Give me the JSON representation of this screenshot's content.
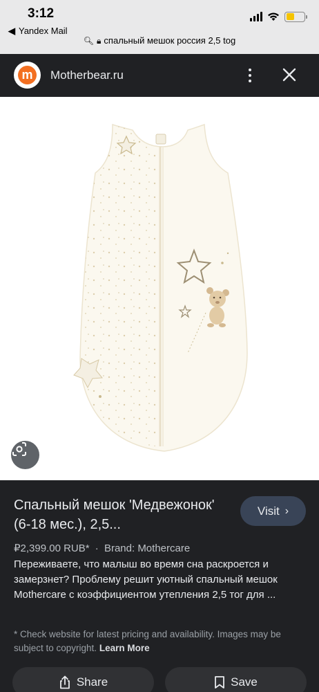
{
  "status_bar": {
    "time": "3:12",
    "back_app": "Yandex Mail",
    "url": "спальный мешок россия 2,5 tog",
    "battery_level": 0.45,
    "battery_color": "#f5c400"
  },
  "site": {
    "logo_letter": "m",
    "logo_color": "#f36f21",
    "name": "Motherbear.ru"
  },
  "product": {
    "title": "Спальный мешок 'Медвежонок' (6-18 мес.), 2,5...",
    "visit_label": "Visit",
    "price": "₽2,399.00 RUB*",
    "separator": "·",
    "brand": "Brand: Mothercare",
    "description": "Переживаете, что малыш во время сна раскроется и замерзнет? Проблему решит уютный спальный мешок Mothercare с коэффициентом утепления 2,5 тог для ...",
    "disclaimer": "* Check website for latest pricing and availability. Images may be subject to copyright.",
    "learn_more": "Learn More"
  },
  "actions": {
    "share_label": "Share",
    "save_label": "Save"
  },
  "icons": {
    "lens": "lens-search-icon",
    "menu": "more-vert-icon",
    "close": "close-icon",
    "share": "share-icon",
    "save": "bookmark-icon"
  },
  "colors": {
    "background": "#202124",
    "visit_button": "#394457",
    "action_button": "#303134"
  }
}
